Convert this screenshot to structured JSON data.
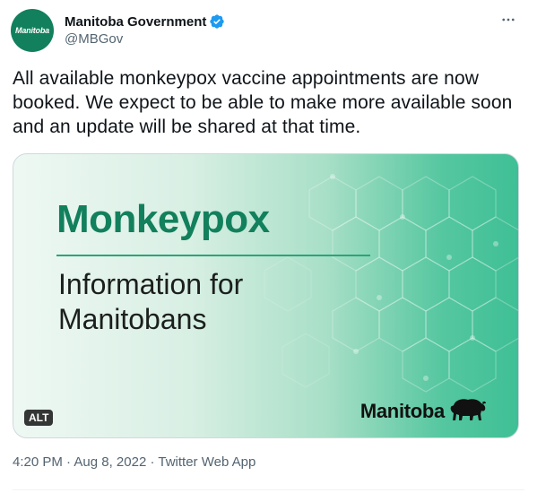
{
  "author": {
    "avatar_text": "Manitoba",
    "display_name": "Manitoba Government",
    "handle": "@MBGov",
    "verified_color": "#1d9bf0"
  },
  "tweet": {
    "text": "All available monkeypox vaccine appointments are now booked. We expect to be able to make more available soon and an update will be shared at that time."
  },
  "media": {
    "title": "Monkeypox",
    "subtitle": "Information for Manitobans",
    "logo_text": "Manitoba",
    "alt_label": "ALT",
    "brand_green": "#12805c"
  },
  "meta": {
    "time": "4:20 PM",
    "separator": "·",
    "date": "Aug 8, 2022",
    "app": "Twitter Web App"
  },
  "icons": [
    "verified-badge-icon",
    "more-options-icon",
    "bison-icon"
  ]
}
